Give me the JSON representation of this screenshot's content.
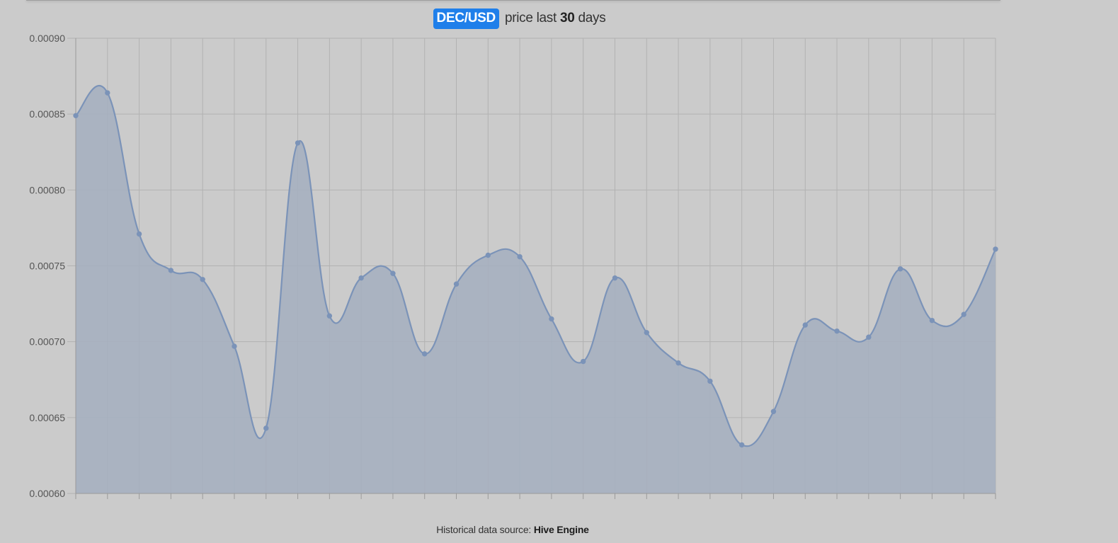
{
  "header": {
    "pair": "DEC/USD",
    "title_prefix": "price last",
    "days": "30",
    "title_suffix": "days"
  },
  "footer": {
    "source_label": "Historical data source:",
    "source_name": "Hive Engine"
  },
  "colors": {
    "background": "#cbcbcb",
    "badge": "#1f7fea",
    "line": "#7b93b8",
    "fill": "#a5afbf",
    "grid": "#b2b2b2"
  },
  "chart_data": {
    "type": "area",
    "title": "DEC/USD price last 30 days",
    "xlabel": "",
    "ylabel": "",
    "ylim": [
      0.0006,
      0.0009
    ],
    "y_ticks": [
      "0.00090",
      "0.00085",
      "0.00080",
      "0.00075",
      "0.00070",
      "0.00065",
      "0.00060"
    ],
    "grid": true,
    "legend": "none",
    "x_tick_labels": "none",
    "series": [
      {
        "values": [
          0.000849,
          0.000864,
          0.000771,
          0.000747,
          0.000741,
          0.000697,
          0.000643,
          0.000831,
          0.000717,
          0.000742,
          0.000745,
          0.000692,
          0.000738,
          0.000757,
          0.000756,
          0.000715,
          0.000687,
          0.000742,
          0.000706,
          0.000686,
          0.000674,
          0.000632,
          0.000654,
          0.000711,
          0.000707,
          0.000703,
          0.000748,
          0.000714,
          0.000718,
          0.000761
        ]
      }
    ]
  }
}
